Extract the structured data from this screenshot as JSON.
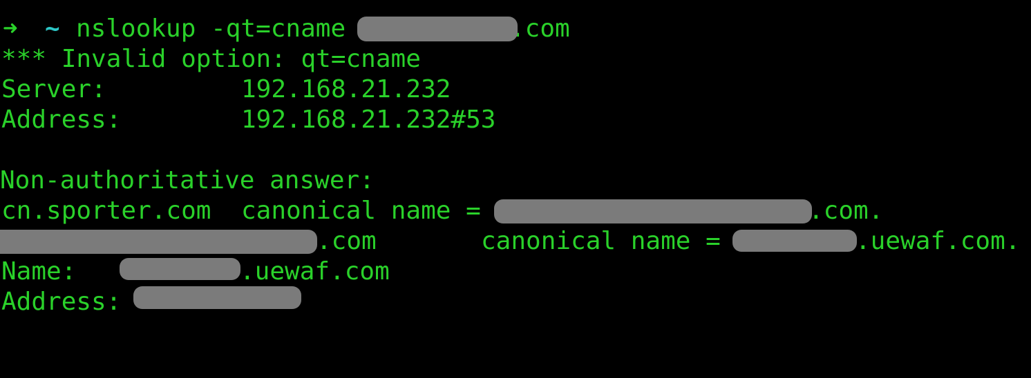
{
  "terminal": {
    "prompt": {
      "arrow": "➜",
      "cwd": "~",
      "command": "nslookup -qt=cname",
      "domain_suffix": ".com"
    },
    "lines": {
      "invalid_option": "*** Invalid option: qt=cname",
      "server_label": "Server:",
      "server_value": "192.168.21.232",
      "address_label": "Address:",
      "address_value": "192.168.21.232#53",
      "non_auth": "Non-authoritative answer:",
      "cname1_host": "cn.sporter.com",
      "cname1_label": "canonical name =",
      "cname1_suffix": ".com.",
      "cname2_suffix": ".com",
      "cname2_label": "canonical name =",
      "cname2_target_suffix": ".uewaf.com.",
      "name_label": "Name:",
      "name_suffix": ".uewaf.com",
      "address2_label": "Address:"
    },
    "colors": {
      "text": "#2ad12a",
      "tilde": "#2cc6c6",
      "background": "#000000",
      "redaction": "#7b7b7b"
    }
  }
}
